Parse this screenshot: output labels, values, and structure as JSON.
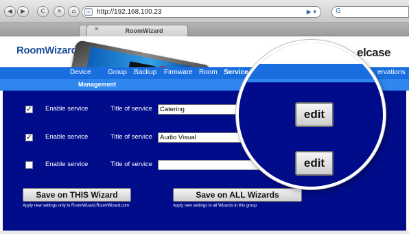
{
  "browser": {
    "nav_buttons": [
      "◀",
      "▶",
      "C",
      "✕",
      "⌂"
    ],
    "url": "http://192.168.100.23",
    "url_go": "▶ ▾",
    "search_prefix": "G"
  },
  "tabs": [
    {
      "close": "✕",
      "title": ""
    },
    {
      "close": "✕",
      "title": "RoomWizard"
    }
  ],
  "header": {
    "logo": "RoomWizard",
    "logo_mark": "®",
    "brand": "elcase"
  },
  "nav": {
    "items": [
      "Device",
      "Group",
      "Backup",
      "Firmware",
      "Room",
      "Service",
      "ervations"
    ],
    "active": "Service",
    "sub": "Management"
  },
  "services": [
    {
      "enable_label": "Enable service",
      "checked": true,
      "mark": "✓",
      "title_label": "Title of service",
      "title_value": "Catering"
    },
    {
      "enable_label": "Enable service",
      "checked": true,
      "mark": "✓",
      "title_label": "Title of service",
      "title_value": "Audio Visual"
    },
    {
      "enable_label": "Enable service",
      "checked": false,
      "mark": "",
      "title_label": "Title of service",
      "title_value": ""
    }
  ],
  "actions": {
    "save_this": "Save on THIS Wizard",
    "save_this_hint": "Apply new settings only to RoomWizard.RoomWizard.com",
    "save_all": "Save on ALL Wizards",
    "save_all_hint": "Apply new settings to all Wizards in this group"
  },
  "magnified": {
    "edit_1": "edit",
    "edit_2": "edit"
  }
}
